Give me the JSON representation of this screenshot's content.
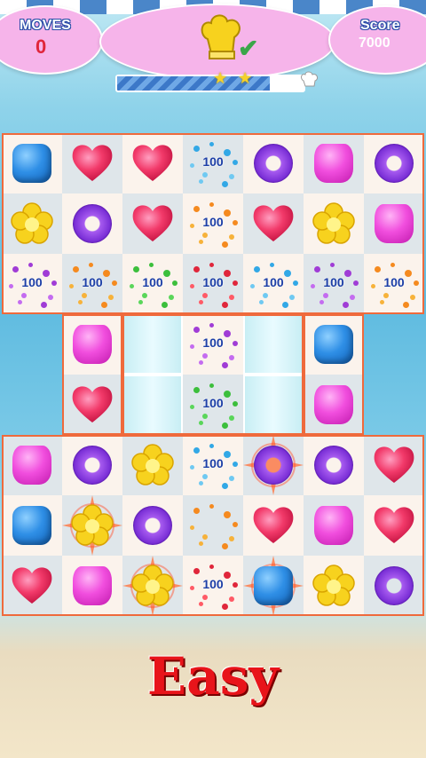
{
  "hud": {
    "moves_label": "MOVES",
    "moves_value": "0",
    "score_label": "Score",
    "score_value": "7000",
    "goal_icon": "chef-hat-icon",
    "goal_status_icon": "check-icon",
    "progress_fraction": 0.82,
    "progress_star_icons": [
      "star-icon",
      "star-icon"
    ],
    "progress_end_icon": "chef-hat-icon"
  },
  "board": {
    "rows": 8,
    "cols": 7,
    "colors": {
      "blue": "#2f8fe6",
      "pink": "#f14ede",
      "purple": "#7a2fd6",
      "red": "#f23a6a",
      "yellow": "#f7d21e",
      "frame": "#ef6a3c"
    },
    "cells": [
      [
        "blue-cube",
        "red-heart",
        "red-heart",
        "pop-100",
        "purple-ring",
        "pink-pillow",
        "purple-ring"
      ],
      [
        "yellow-flower",
        "purple-ring",
        "red-heart",
        "pop-100",
        "red-heart",
        "yellow-flower",
        "pink-pillow"
      ],
      [
        "pop-100",
        "pop-100",
        "pop-100",
        "pop-100",
        "pop-100",
        "pop-100",
        "pop-100"
      ],
      [
        "none",
        "pink-pillow",
        "empty",
        "pop-100",
        "empty",
        "blue-cube",
        "none"
      ],
      [
        "none",
        "red-heart",
        "empty",
        "pop-100",
        "empty",
        "pink-pillow",
        "none"
      ],
      [
        "pink-pillow",
        "purple-ring",
        "yellow-flower",
        "pop-100",
        "purple-ring-striped",
        "purple-ring",
        "red-heart"
      ],
      [
        "blue-cube",
        "yellow-flower-striped",
        "purple-ring",
        "pop-plain",
        "red-heart",
        "pink-pillow",
        "red-heart"
      ],
      [
        "red-heart",
        "pink-pillow",
        "yellow-flower-striped",
        "pop-100",
        "blue-cube-striped",
        "yellow-flower",
        "purple-ring"
      ]
    ],
    "pop_text": "100"
  },
  "footer": {
    "difficulty": "Easy"
  }
}
